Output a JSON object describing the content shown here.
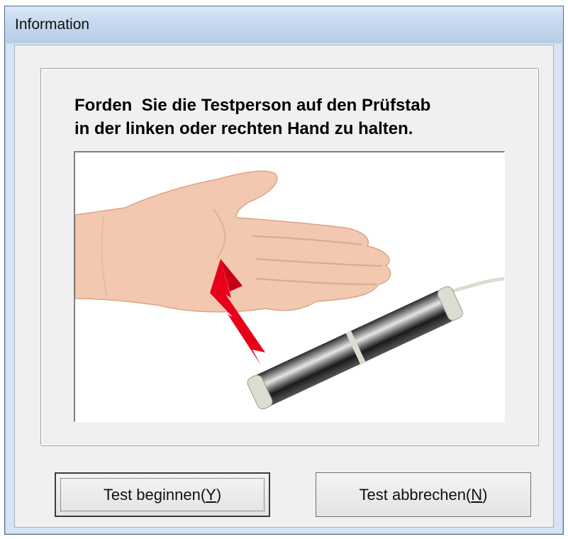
{
  "window": {
    "title": "Information"
  },
  "dialog": {
    "instruction_line1": "Forden  Sie die Testperson auf den Prüfstab",
    "instruction_line2": "in der linken oder rechten Hand zu halten."
  },
  "illustration": {
    "icons": [
      "hand-icon",
      "arrow-icon",
      "test-rod-icon"
    ],
    "arrow_color": "#e8001a"
  },
  "buttons": {
    "start": {
      "label": "Test beginnen(",
      "hotkey": "Y",
      "suffix": ")"
    },
    "cancel": {
      "label": "Test abbrechen(",
      "hotkey": "N",
      "suffix": ")"
    }
  }
}
